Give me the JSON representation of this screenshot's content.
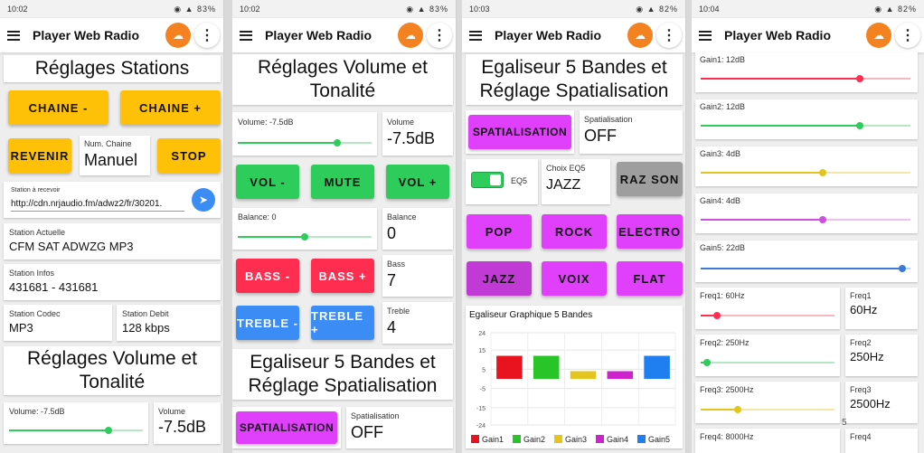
{
  "app": {
    "title": "Player Web Radio"
  },
  "screens": [
    {
      "time": "10:02",
      "battery": "83%"
    },
    {
      "time": "10:02",
      "battery": "83%"
    },
    {
      "time": "10:03",
      "battery": "82%"
    },
    {
      "time": "10:04",
      "battery": "82%"
    }
  ],
  "s1": {
    "title": "Réglages Stations",
    "chaine_minus": "CHAINE -",
    "chaine_plus": "CHAINE +",
    "revenir": "REVENIR",
    "num_chaine_label": "Num. Chaine",
    "num_chaine_value": "Manuel",
    "stop": "STOP",
    "station_input_label": "Station à recevoir",
    "station_input_value": "http://cdn.nrjaudio.fm/adwz2/fr/30201.",
    "station_actuelle_label": "Station Actuelle",
    "station_actuelle_value": "CFM SAT ADWZG MP3",
    "station_infos_label": "Station Infos",
    "station_infos_value": "431681 - 431681",
    "codec_label": "Station Codec",
    "codec_value": "MP3",
    "debit_label": "Station Debit",
    "debit_value": "128 kbps",
    "vol_title": "Réglages Volume et Tonalité",
    "volume_slider_label": "Volume: -7.5dB",
    "volume_label": "Volume",
    "volume_value": "-7.5dB"
  },
  "s2": {
    "title": "Réglages Volume et Tonalité",
    "volume_slider_label": "Volume: -7.5dB",
    "volume_label": "Volume",
    "volume_value": "-7.5dB",
    "vol_minus": "VOL -",
    "mute": "MUTE",
    "vol_plus": "VOL +",
    "balance_slider_label": "Balance: 0",
    "balance_label": "Balance",
    "balance_value": "0",
    "bass_minus": "BASS -",
    "bass_plus": "BASS +",
    "bass_label": "Bass",
    "bass_value": "7",
    "treble_minus": "TREBLE -",
    "treble_plus": "TREBLE +",
    "treble_label": "Treble",
    "treble_value": "4",
    "eq_title": "Egaliseur 5 Bandes et Réglage Spatialisation",
    "spatial_button": "SPATIALISATION",
    "spatial_label": "Spatialisation",
    "spatial_value": "OFF"
  },
  "s3": {
    "title": "Egaliseur 5 Bandes et Réglage Spatialisation",
    "spatial_button": "SPATIALISATION",
    "spatial_label": "Spatialisation",
    "spatial_value": "OFF",
    "eq5_switch_label": "EQ5",
    "choix_label": "Choix EQ5",
    "choix_value": "JAZZ",
    "raz_son": "RAZ SON",
    "pop": "POP",
    "rock": "ROCK",
    "electro": "ELECTRO",
    "jazz": "JAZZ",
    "voix": "VOIX",
    "flat": "FLAT",
    "chart_title": "Egaliseur Graphique 5 Bandes"
  },
  "s4": {
    "gain1": "Gain1: 12dB",
    "gain2": "Gain2: 12dB",
    "gain3": "Gain3: 4dB",
    "gain4": "Gain4: 4dB",
    "gain5": "Gain5: 22dB",
    "freq1_slider": "Freq1: 60Hz",
    "freq1_label": "Freq1",
    "freq1_value": "60Hz",
    "freq2_slider": "Freq2: 250Hz",
    "freq2_label": "Freq2",
    "freq2_value": "250Hz",
    "freq3_slider": "Freq3: 2500Hz",
    "freq3_label": "Freq3",
    "freq3_value": "2500Hz",
    "freq4_slider": "Freq4: 8000Hz",
    "freq4_label": "Freq4",
    "page_number": "5"
  },
  "sliders": {
    "volume": 0.74,
    "balance": 0.5,
    "gain1": 0.76,
    "gain2": 0.76,
    "gain3": 0.58,
    "gain4": 0.58,
    "gain5": 0.96,
    "freq1": 0.12,
    "freq2": 0.05,
    "freq3": 0.28
  },
  "chart_data": {
    "type": "bar",
    "title": "Egaliseur Graphique 5 Bandes",
    "categories": [
      "Gain1",
      "Gain2",
      "Gain3",
      "Gain4",
      "Gain5"
    ],
    "values": [
      12,
      12,
      4,
      4,
      12
    ],
    "colors": [
      "#e8131f",
      "#28c428",
      "#e3c51d",
      "#cf22cf",
      "#1f7ff0"
    ],
    "ylim": [
      -24,
      24
    ],
    "yticks": [
      "24",
      "15",
      "5",
      "-5",
      "-15",
      "-24"
    ],
    "xlabel": "",
    "ylabel": "",
    "legend": "bottom",
    "grid": true
  }
}
